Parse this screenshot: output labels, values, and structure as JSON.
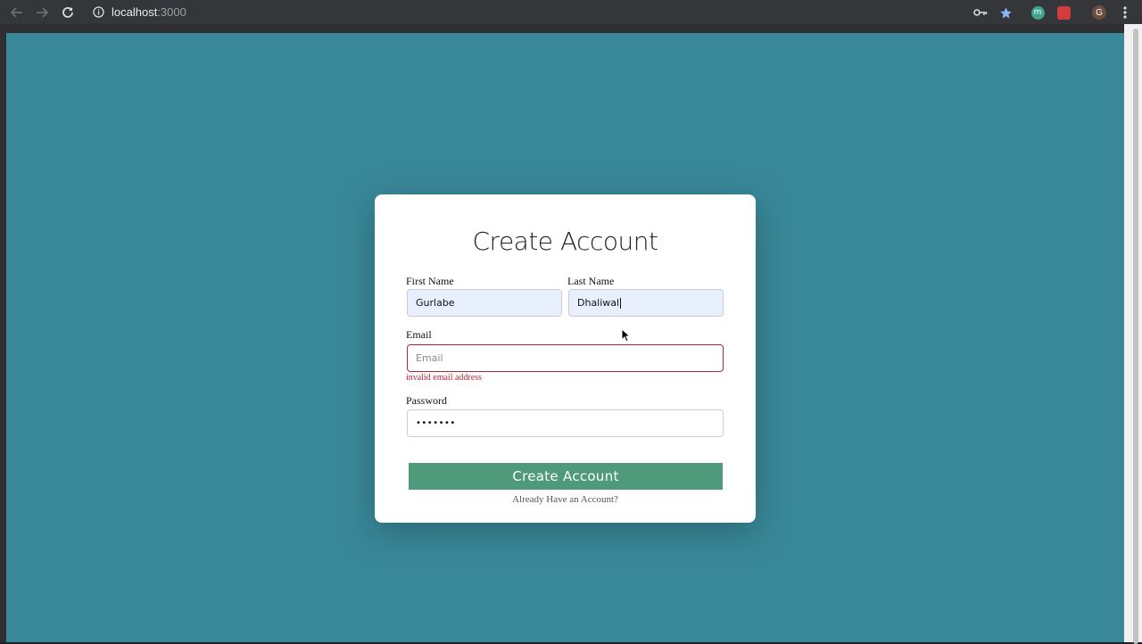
{
  "browser": {
    "url_host": "localhost",
    "url_port": ":3000",
    "icons": [
      "back-arrow-icon",
      "forward-arrow-icon",
      "reload-icon",
      "info-icon",
      "key-icon",
      "star-icon",
      "extension-m-icon",
      "extension-red-icon",
      "profile-avatar",
      "menu-icon"
    ],
    "avatar_letter": "G"
  },
  "page": {
    "background_color": "#398899"
  },
  "form": {
    "title": "Create Account",
    "first_name": {
      "label": "First Name",
      "value": "Gurlabe"
    },
    "last_name": {
      "label": "Last Name",
      "value": "Dhaliwal"
    },
    "email": {
      "label": "Email",
      "placeholder": "Email",
      "value": "",
      "error": "invalid email address"
    },
    "password": {
      "label": "Password",
      "value": "•••••••"
    },
    "submit_label": "Create Account",
    "login_link": "Already Have an Account?",
    "accent_color": "#4e9a7a",
    "error_color": "#b3263a"
  }
}
